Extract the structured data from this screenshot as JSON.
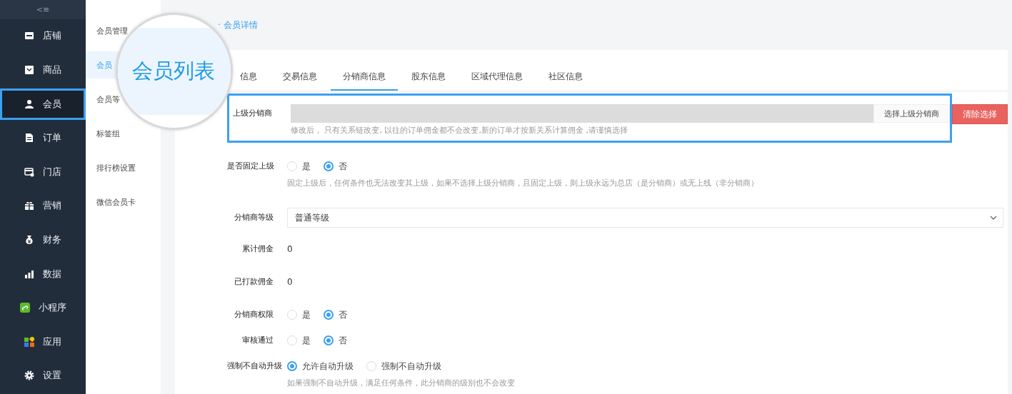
{
  "sidebar": {
    "collapse_icon": "<≡",
    "items": [
      {
        "label": "店铺",
        "selected": false
      },
      {
        "label": "商品",
        "selected": false
      },
      {
        "label": "会员",
        "selected": true
      },
      {
        "label": "订单",
        "selected": false
      },
      {
        "label": "门店",
        "selected": false
      },
      {
        "label": "营销",
        "selected": false
      },
      {
        "label": "财务",
        "selected": false
      },
      {
        "label": "数据",
        "selected": false
      },
      {
        "label": "小程序",
        "selected": false
      },
      {
        "label": "应用",
        "selected": false
      },
      {
        "label": "设置",
        "selected": false
      }
    ]
  },
  "submenu": {
    "items": [
      {
        "label": "会员管理",
        "selected": false
      },
      {
        "label": "会员",
        "selected": true
      },
      {
        "label": "会员等",
        "selected": false
      },
      {
        "label": "标签组",
        "selected": false
      },
      {
        "label": "排行榜设置",
        "selected": false
      },
      {
        "label": "微信会员卡",
        "selected": false
      }
    ]
  },
  "magnifier": {
    "text": "会员列表"
  },
  "breadcrumb": {
    "separator": "·",
    "current": "会员详情"
  },
  "tabs": [
    {
      "label": "信息",
      "selected": false
    },
    {
      "label": "交易信息",
      "selected": false
    },
    {
      "label": "分销商信息",
      "selected": true
    },
    {
      "label": "股东信息",
      "selected": false
    },
    {
      "label": "区域代理信息",
      "selected": false
    },
    {
      "label": "社区信息",
      "selected": false
    }
  ],
  "form": [
    {
      "kind": "picker",
      "label": "上级分销商",
      "highlighted": true,
      "button": "选择上级分销商",
      "clear_button": "清除选择",
      "help": "修改后， 只有关系链改变, 以往的订单佣金都不会改变,新的订单才按新关系计算佣金 ,请谨慎选择"
    },
    {
      "kind": "radio",
      "label": "是否固定上级",
      "highlighted": false,
      "options": [
        {
          "label": "是",
          "selected": false
        },
        {
          "label": "否",
          "selected": true
        }
      ],
      "help": "固定上级后，任何条件也无法改变其上级，如果不选择上级分销商，且固定上级，则上级永远为总店（是分销商）或无上线（非分销商）"
    },
    {
      "kind": "select",
      "label": "分销商等级",
      "highlighted": false,
      "value": "普通等级"
    },
    {
      "kind": "text",
      "label": "累计佣金",
      "highlighted": false,
      "value": "0"
    },
    {
      "kind": "text",
      "label": "已打款佣金",
      "highlighted": false,
      "value": "0"
    },
    {
      "kind": "radio",
      "label": "分销商权限",
      "highlighted": false,
      "options": [
        {
          "label": "是",
          "selected": false
        },
        {
          "label": "否",
          "selected": true
        }
      ]
    },
    {
      "kind": "radio",
      "label": "审核通过",
      "highlighted": false,
      "options": [
        {
          "label": "是",
          "selected": false
        },
        {
          "label": "否",
          "selected": true
        }
      ]
    },
    {
      "kind": "radio",
      "label": "强制不自动升级",
      "highlighted": false,
      "options": [
        {
          "label": "允许自动升级",
          "selected": true
        },
        {
          "label": "强制不自动升级",
          "selected": false
        }
      ],
      "help": "如果强制不自动升级，满足任何条件，此分销商的级别也不会改变"
    }
  ]
}
